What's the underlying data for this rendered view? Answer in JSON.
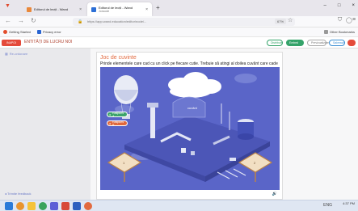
{
  "browser": {
    "tabs": [
      {
        "label": "Editorul de lecții - Wand"
      },
      {
        "label": "Editorul de lecții - Wand",
        "sublabel": "Joncode"
      }
    ],
    "url": "https://app.wand.education/editor/node/...",
    "zoom": "67%",
    "bookmarks": [
      "Getting Started",
      "Privacy error"
    ],
    "other_bookmarks": "Other Bookmarks"
  },
  "app": {
    "back_label": "INAPOI",
    "title": "ENTITĂȚI DE LUCRU NOI",
    "buttons": {
      "share": "Distribuie",
      "embed": "Embed",
      "print": "Previzualizare",
      "save": "Salvează"
    },
    "side": {
      "nav_label": "Re-ordonare",
      "feedback": "Trimite feedback"
    }
  },
  "game": {
    "title": "Joc de cuvinte",
    "instructions": "Prinde elementele care cad cu un click pe fiecare cutie. Trebuie să atingi al doilea cuvânt care cade",
    "answers": [
      "Răspuns A",
      "Răspuns B"
    ],
    "bubble_word": "cuvânt",
    "sign_left": "1",
    "sign_right": "2",
    "colors": {
      "scene_bg": "#5a65c8",
      "title": "#e26a3f",
      "accent_green": "#35a36a",
      "accent_red": "#e44a3a"
    }
  },
  "taskbar": {
    "time": "4:37 PM",
    "date": "",
    "lang": "ENG"
  }
}
